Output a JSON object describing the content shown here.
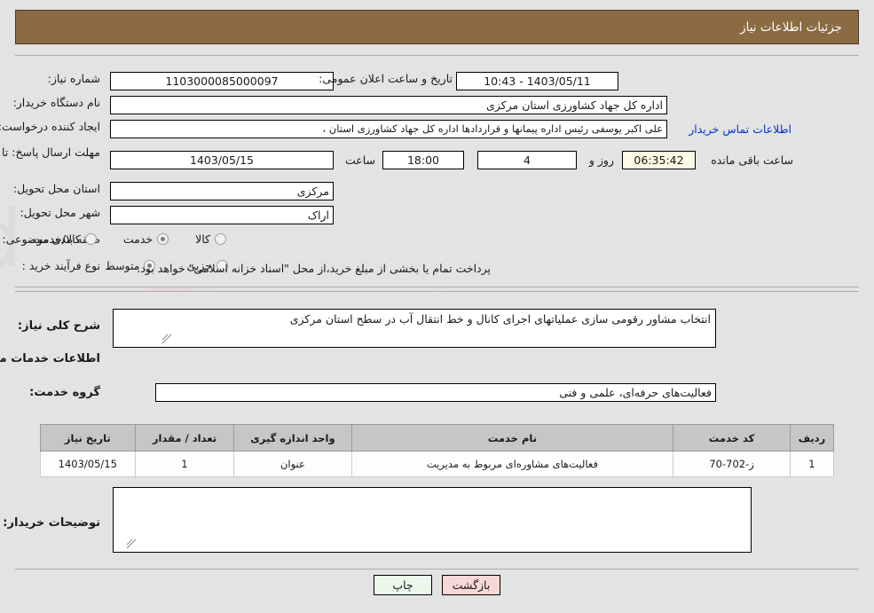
{
  "header": {
    "title": "جزئیات اطلاعات نیاز"
  },
  "main_form": {
    "need_number_label": "شماره نیاز:",
    "need_number_value": "1103000085000097",
    "announce_datetime_label": "تاریخ و ساعت اعلان عمومی:",
    "announce_datetime_value": "1403/05/11 - 10:43",
    "buyer_org_label": "نام دستگاه خریدار:",
    "buyer_org_value": "اداره کل جهاد کشاورزی استان مرکزی",
    "requester_label": "ایجاد کننده درخواست:",
    "requester_value": "علی اکبر یوسفی رئیس اداره پیمانها و قراردادها اداره کل جهاد کشاورزی استان ،",
    "contact_link": "اطلاعات تماس خریدار",
    "deadline_label": "مهلت ارسال پاسخ: تا تاریخ:",
    "deadline_date": "1403/05/15",
    "deadline_time_label": "ساعت",
    "deadline_time": "18:00",
    "days_value": "4",
    "days_label": "روز و",
    "remaining_time": "06:35:42",
    "remaining_label": "ساعت باقی مانده",
    "province_label": "استان محل تحویل:",
    "province_value": "مرکزی",
    "city_label": "شهر محل تحویل:",
    "city_value": "اراک",
    "category_label": "طبقه بندی موضوعی:",
    "category_options": [
      {
        "label": "کالا",
        "selected": false
      },
      {
        "label": "خدمت",
        "selected": true
      },
      {
        "label": "کالا/خدمت",
        "selected": false
      }
    ],
    "process_label": "نوع فرآیند خرید :",
    "process_options": [
      {
        "label": "جزیی",
        "selected": false
      },
      {
        "label": "متوسط",
        "selected": true
      }
    ],
    "payment_note": "پرداخت تمام یا بخشی از مبلغ خرید،از محل \"اسناد خزانه اسلامی\" خواهد بود."
  },
  "description": {
    "general_need_label": "شرح کلی نیاز:",
    "general_need_value": "انتخاب مشاور رقومی سازی عملیاتهای اجرای کانال و خط انتقال آب در سطح استان مرکزی",
    "services_section_title": "اطلاعات خدمات مورد نیاز",
    "service_group_label": "گروه خدمت:",
    "service_group_value": "فعالیت‌های حرفه‌ای، علمی و فنی",
    "buyer_notes_label": "توضیحات خریدار:",
    "buyer_notes_value": ""
  },
  "table": {
    "columns": [
      "ردیف",
      "کد خدمت",
      "نام خدمت",
      "واحد اندازه گیری",
      "تعداد / مقدار",
      "تاریخ نیاز"
    ],
    "rows": [
      {
        "row_no": "1",
        "service_code": "ز-702-70",
        "service_name": "فعالیت‌های مشاوره‌ای مربوط به مدیریت",
        "unit": "عنوان",
        "quantity": "1",
        "need_date": "1403/05/15"
      }
    ]
  },
  "buttons": {
    "print": "چاپ",
    "back": "بازگشت"
  },
  "colors": {
    "header_bg": "#8b6b43",
    "page_bg": "#e3e3e3",
    "link": "#0033cc",
    "print_btn": "#eaf7ea",
    "back_btn": "#f8d7d7",
    "highlight_field": "#fbfbe4",
    "table_header": "#c6c6c6"
  },
  "watermark": {
    "text": "anaTender.net"
  }
}
